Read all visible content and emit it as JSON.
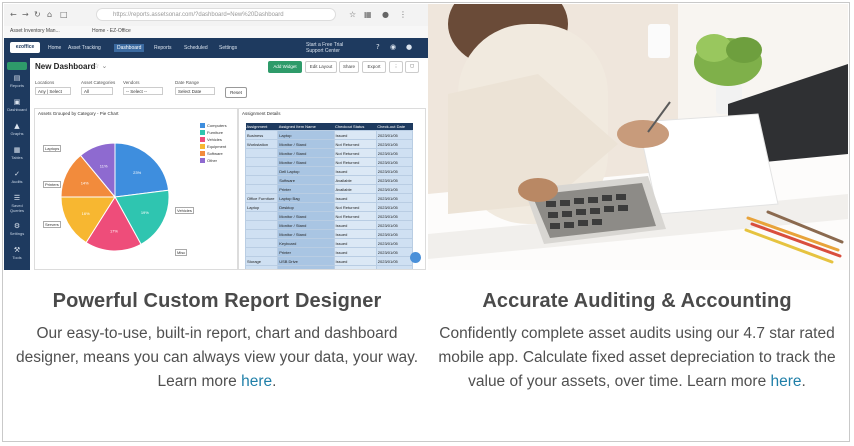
{
  "browser": {
    "url": "https://reports.assetsonar.com/?dashboard=New%20Dashboard"
  },
  "bookmarks": [
    "Asset Inventory Man...",
    "Home - EZ-Office"
  ],
  "app": {
    "logo": "ezoffice",
    "tabs": [
      "Home",
      "Asset Tracking",
      "Dashboard",
      "Reports",
      "Scheduled",
      "Settings"
    ],
    "right_line1": "Start a Free Trial",
    "right_line2": "Support Center"
  },
  "sidebar": {
    "items": [
      "Reports",
      "Dashboard",
      "Graphs",
      "Tables",
      "Audits",
      "Saved Queries",
      "Settings",
      "Tools"
    ]
  },
  "dashboard": {
    "title": "New Dashboard",
    "buttons": [
      "Add Widget",
      "Edit Layout",
      "Share",
      "Export"
    ],
    "filters": [
      {
        "label": "Locations",
        "value": "Any | Select"
      },
      {
        "label": "Asset Categories",
        "value": "All"
      },
      {
        "label": "Vendors",
        "value": "-- Select --"
      },
      {
        "label": "Date Range",
        "value": "Select Date"
      }
    ],
    "reset": "Reset"
  },
  "chart_panel": {
    "title": "Assets Grouped by Category - Pie Chart",
    "legend": [
      "Computers",
      "Furniture",
      "Vehicles",
      "Equipment",
      "Software",
      "Other"
    ],
    "callouts": [
      "Laptops",
      "Printers",
      "Servers",
      "Vehicles",
      "Misc"
    ]
  },
  "chart_data": {
    "type": "pie",
    "categories": [
      "Computers",
      "Furniture",
      "Vehicles",
      "Equipment",
      "Software",
      "Other"
    ],
    "values": [
      23,
      19,
      17,
      16,
      14,
      11
    ],
    "colors": [
      "#3e8ede",
      "#2fc5b0",
      "#ee4d7a",
      "#f7b731",
      "#f28b3c",
      "#8e6ad0"
    ]
  },
  "table_panel": {
    "title": "Assignment Details",
    "columns": [
      "Assignment",
      "Assigned Item Name",
      "Checkout Status",
      "Check-out Date"
    ],
    "rows": [
      [
        "Business",
        "Laptop",
        "Issued",
        "2023/01/05"
      ],
      [
        "Workstation",
        "Monitor / Stand",
        "Not Returned",
        "2023/01/05"
      ],
      [
        "",
        "Monitor / Stand",
        "Not Returned",
        "2023/01/05"
      ],
      [
        "",
        "Monitor / Stand",
        "Not Returned",
        "2023/01/05"
      ],
      [
        "",
        "Dell Laptop",
        "Issued",
        "2023/01/05"
      ],
      [
        "",
        "Software",
        "Available",
        "2023/01/05"
      ],
      [
        "",
        "Printer",
        "Available",
        "2023/01/05"
      ],
      [
        "Office Furniture",
        "Laptop Bag",
        "Issued",
        "2023/01/05"
      ],
      [
        "Laptop",
        "Desktop",
        "Not Returned",
        "2023/01/05"
      ],
      [
        "",
        "Monitor / Stand",
        "Not Returned",
        "2023/01/05"
      ],
      [
        "",
        "Monitor / Stand",
        "Issued",
        "2023/01/05"
      ],
      [
        "",
        "Monitor / Stand",
        "Issued",
        "2023/01/05"
      ],
      [
        "",
        "Keyboard",
        "Issued",
        "2023/01/05"
      ],
      [
        "",
        "Printer",
        "Issued",
        "2023/01/05"
      ],
      [
        "Storage",
        "USB Drive",
        "Issued",
        "2023/01/05"
      ],
      [
        "",
        "Drive",
        "Not Returned",
        "2023/01/05"
      ]
    ]
  },
  "features": [
    {
      "title": "Powerful Custom Report Designer",
      "body": "Our easy-to-use, built-in report, chart and dashboard designer, means you can always view your data, your way. Learn more ",
      "link": "here",
      "tail": "."
    },
    {
      "title": "Accurate Auditing & Accounting",
      "body": "Confidently complete asset audits using our 4.7 star rated mobile app. Calculate fixed asset depreciation to track the value of your assets, over time. Learn more ",
      "link": "here",
      "tail": "."
    }
  ]
}
